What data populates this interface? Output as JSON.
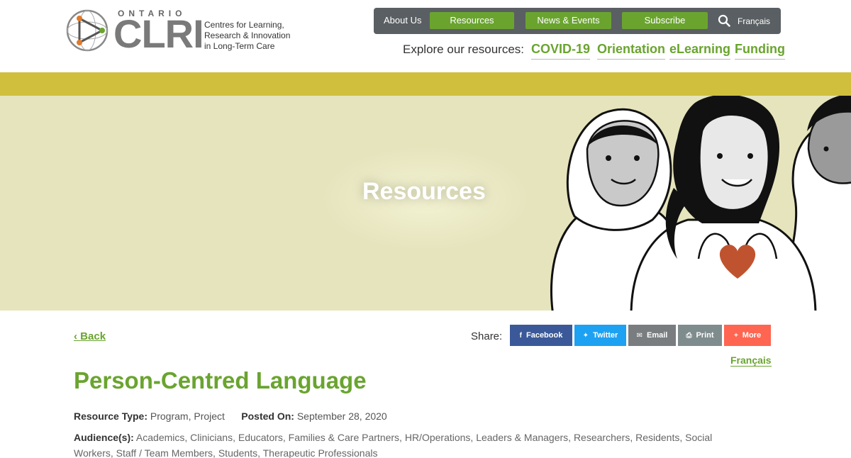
{
  "logo": {
    "ontario": "ONTARIO",
    "clri": "CLRI",
    "subtitle_line1": "Centres for Learning,",
    "subtitle_line2": "Research & Innovation",
    "subtitle_line3": "in Long-Term Care"
  },
  "topnav": {
    "about": "About Us",
    "resources": "Resources",
    "news": "News & Events",
    "subscribe": "Subscribe",
    "search_icon": "search-icon",
    "francais": "Français"
  },
  "explore": {
    "label": "Explore our resources:",
    "links": [
      "COVID-19",
      "Orientation",
      "eLearning",
      "Funding"
    ]
  },
  "hero": {
    "title": "Resources"
  },
  "content": {
    "back": "Back",
    "share_label": "Share:",
    "share_buttons": [
      {
        "label": "Facebook",
        "icon": "f",
        "color": "#3b5998"
      },
      {
        "label": "Twitter",
        "icon": "🐦",
        "color": "#1da1f2"
      },
      {
        "label": "Email",
        "icon": "✉",
        "color": "#7a7d7f"
      },
      {
        "label": "Print",
        "icon": "⎙",
        "color": "#7f8c8d"
      },
      {
        "label": "More",
        "icon": "+",
        "color": "#ff6550"
      }
    ],
    "francais": "Français",
    "title": "Person-Centred Language",
    "resource_type_label": "Resource Type:",
    "resource_type_value": "Program, Project",
    "posted_label": "Posted On:",
    "posted_value": "September 28, 2020",
    "audience_label": "Audience(s):",
    "audience_value": "Academics, Clinicians, Educators, Families & Care Partners, HR/Operations, Leaders & Managers, Researchers, Residents, Social Workers, Staff / Team Members, Students, Therapeutic Professionals"
  },
  "colors": {
    "accent_green": "#6aa42f",
    "nav_gray": "#5a5f63",
    "band_yellow": "#cfbf3d",
    "hero_bg": "#e6e4bd"
  }
}
